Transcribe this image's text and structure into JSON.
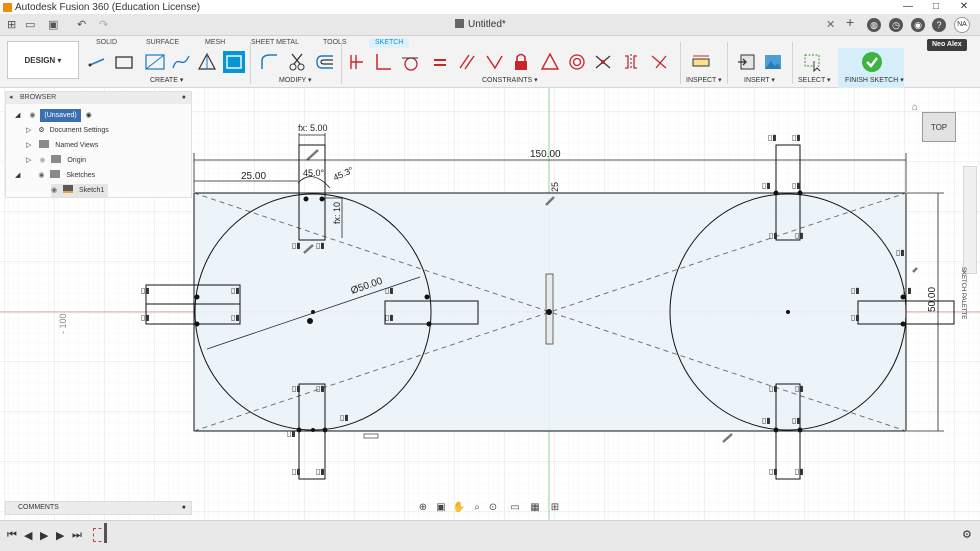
{
  "titlebar": {
    "app_title": "Autodesk Fusion 360 (Education License)",
    "minimize": "—",
    "maximize": "□",
    "close": "✕"
  },
  "tabbar": {
    "doc_title": "Untitled*",
    "help_label": "?",
    "avatar_initials": "NA"
  },
  "ribbon": {
    "workspace": "DESIGN ▾",
    "tabs": [
      "SOLID",
      "SURFACE",
      "MESH",
      "SHEET METAL",
      "TOOLS",
      "SKETCH"
    ],
    "active_tab": "SKETCH",
    "groups": {
      "create": "CREATE ▾",
      "modify": "MODIFY ▾",
      "constraints": "CONSTRAINTS ▾",
      "inspect": "INSPECT ▾",
      "insert": "INSERT ▾",
      "select": "SELECT ▾",
      "finish": "FINISH SKETCH ▾"
    },
    "user": "Neo Alex"
  },
  "browser": {
    "title": "BROWSER",
    "items": [
      {
        "label": "(Unsaved)"
      },
      {
        "label": "Document Settings"
      },
      {
        "label": "Named Views"
      },
      {
        "label": "Origin"
      },
      {
        "label": "Sketches"
      },
      {
        "label": "Sketch1"
      }
    ]
  },
  "comments": {
    "label": "COMMENTS"
  },
  "viewcube": {
    "face": "TOP"
  },
  "sketch_palette": {
    "label": "SKETCH PALETTE"
  },
  "sketch": {
    "dims": {
      "overall_length": "150.00",
      "offset_25": "25.00",
      "fx_width": "fx: 5.00",
      "angle_a": "45.0°",
      "angle_b": "45.3°",
      "fx_height": "fx: 10",
      "diameter": "Ø50.00",
      "height": "50.00",
      "vertical_25": "25",
      "ruler_minus_100": "- 100"
    }
  },
  "colors": {
    "accent": "#0696d7",
    "sketch_fill": "#eaf3fa",
    "origin_line": "#e03a3a",
    "y_axis": "#3cb371",
    "finish": "#3db343"
  }
}
